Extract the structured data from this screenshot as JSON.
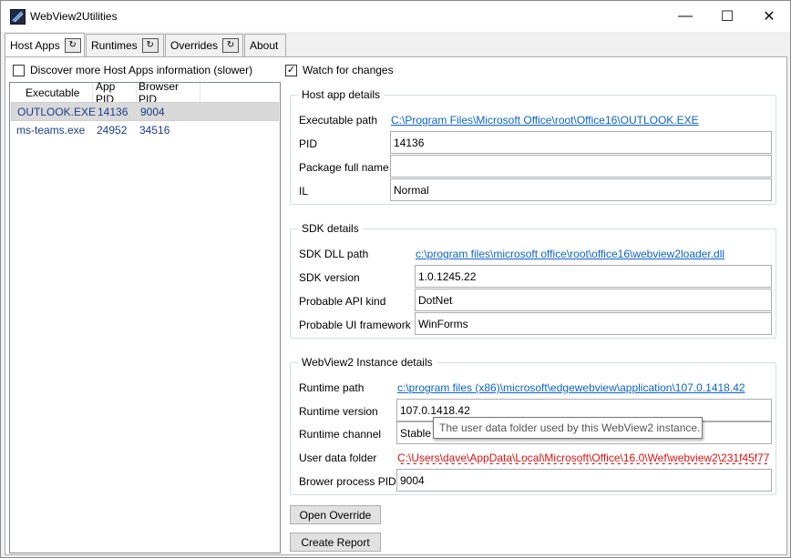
{
  "window": {
    "title": "WebView2Utilities",
    "minimize": "—",
    "maximize": "☐",
    "close": "✕"
  },
  "tabs": [
    {
      "label": "Host Apps",
      "icon": "refresh-icon",
      "glyph": "↻"
    },
    {
      "label": "Runtimes",
      "icon": "refresh-icon",
      "glyph": "↻"
    },
    {
      "label": "Overrides",
      "icon": "refresh-icon",
      "glyph": "↻"
    },
    {
      "label": "About"
    }
  ],
  "options": {
    "discover_label": "Discover more Host Apps information (slower)",
    "discover_checked": false,
    "watch_label": "Watch for changes",
    "watch_checked": true,
    "check_glyph": "✓"
  },
  "host_list": {
    "columns": [
      "Executable",
      "App PID",
      "Browser PID"
    ],
    "rows": [
      {
        "executable": "OUTLOOK.EXE",
        "app_pid": "14136",
        "browser_pid": "9004",
        "selected": true
      },
      {
        "executable": "ms-teams.exe",
        "app_pid": "24952",
        "browser_pid": "34516",
        "selected": false
      }
    ]
  },
  "host_app_details": {
    "title": "Host app details",
    "executable_path_label": "Executable path",
    "executable_path": "C:\\Program Files\\Microsoft Office\\root\\Office16\\OUTLOOK.EXE",
    "pid_label": "PID",
    "pid": "14136",
    "package_label": "Package full name",
    "package": "",
    "il_label": "IL",
    "il": "Normal"
  },
  "sdk_details": {
    "title": "SDK details",
    "dll_path_label": "SDK DLL path",
    "dll_path": "c:\\program files\\microsoft office\\root\\office16\\webview2loader.dll",
    "version_label": "SDK version",
    "version": "1.0.1245.22",
    "api_kind_label": "Probable API kind",
    "api_kind": "DotNet",
    "ui_framework_label": "Probable UI framework",
    "ui_framework": "WinForms"
  },
  "instance_details": {
    "title": "WebView2 Instance details",
    "runtime_path_label": "Runtime path",
    "runtime_path": "c:\\program files (x86)\\microsoft\\edgewebview\\application\\107.0.1418.42",
    "runtime_version_label": "Runtime version",
    "runtime_version": "107.0.1418.42",
    "runtime_channel_label": "Runtime channel",
    "runtime_channel": "Stable WebView2 Runtime",
    "user_data_label": "User data folder",
    "user_data": "C:\\Users\\dave\\AppData\\Local\\Microsoft\\Office\\16.0\\Wef\\webview2\\231f45f77",
    "browser_pid_label": "Brower process PID",
    "browser_pid": "9004"
  },
  "tooltip": "The user data folder used by this WebView2 instance.",
  "buttons": {
    "open_override": "Open Override",
    "create_report": "Create Report"
  },
  "colors": {
    "link": "#0b63c9",
    "selection": "#d9d9d9"
  }
}
